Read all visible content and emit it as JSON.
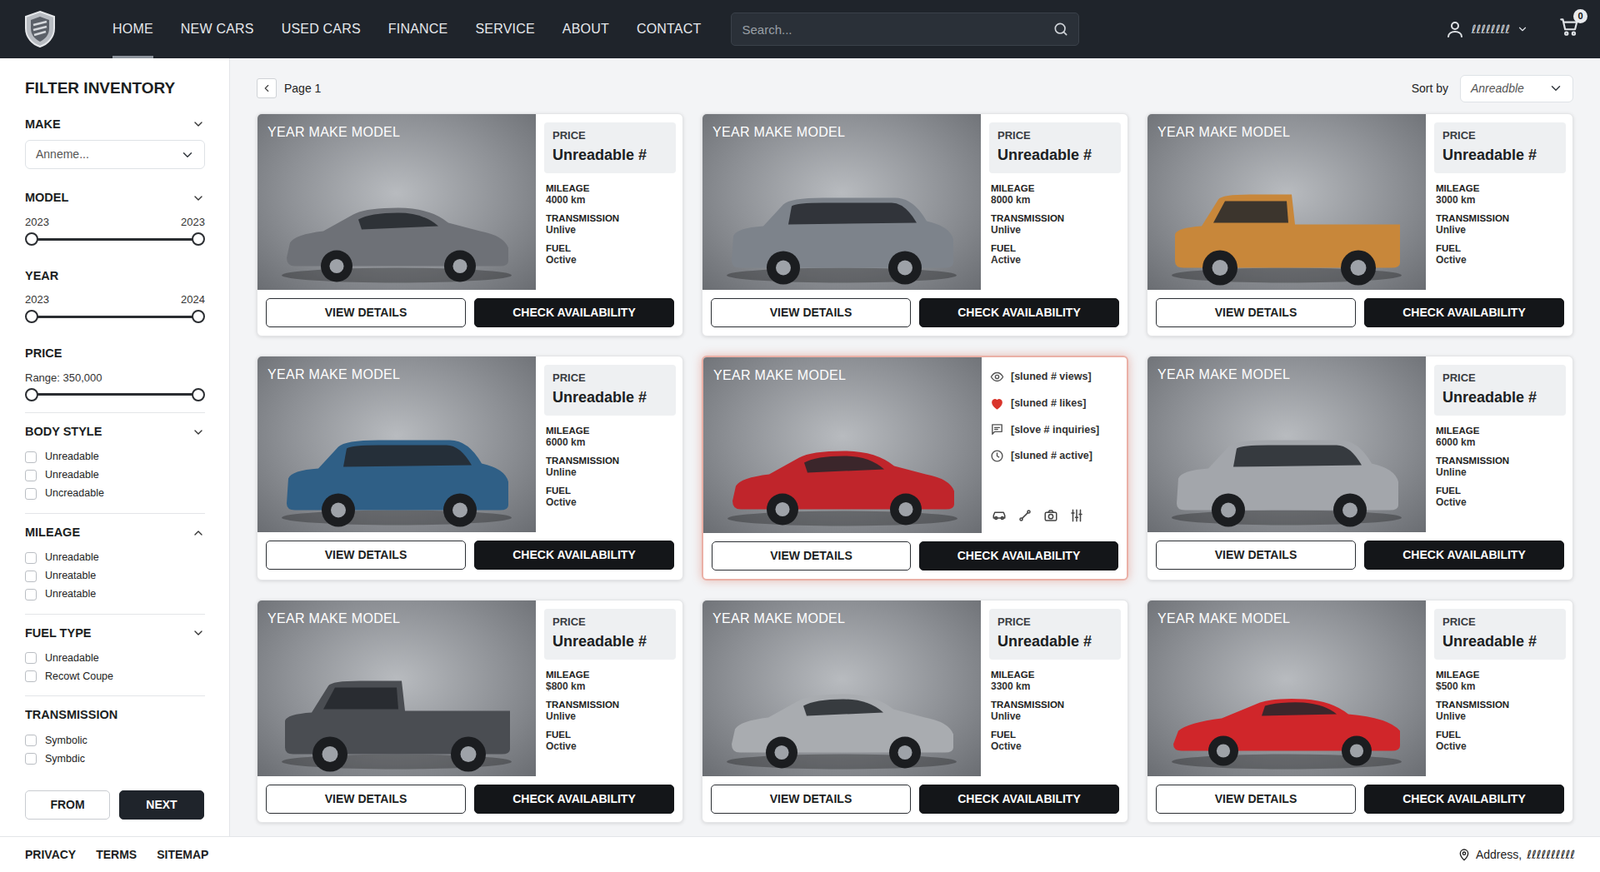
{
  "nav": {
    "items": [
      {
        "label": "HOME",
        "selected": true
      },
      {
        "label": "NEW CARS",
        "selected": false
      },
      {
        "label": "USED CARS",
        "selected": false
      },
      {
        "label": "FINANCE",
        "selected": false
      },
      {
        "label": "SERVICE",
        "selected": false
      },
      {
        "label": "ABOUT",
        "selected": false
      },
      {
        "label": "CONTACT",
        "selected": false
      }
    ]
  },
  "search": {
    "placeholder": "Search..."
  },
  "user": {
    "name": "ℓℓℓℓℓℓℓℓ"
  },
  "cart": {
    "count": "0"
  },
  "sidebar": {
    "title": "FILTER INVENTORY",
    "sections": [
      {
        "kind": "select",
        "title": "MAKE",
        "collapsible": true,
        "expanded": false,
        "value": "Anneme..."
      },
      {
        "kind": "range",
        "title": "MODEL",
        "collapsible": true,
        "expanded": false,
        "min": "2023",
        "max": "2023",
        "low": 0,
        "level": 1
      },
      {
        "kind": "range",
        "title": "YEAR",
        "collapsible": false,
        "min": "2023",
        "max": "2024",
        "low": 0,
        "level": 1
      },
      {
        "kind": "range",
        "title": "PRICE",
        "collapsible": false,
        "reading": "Range: 350,000",
        "low": 0,
        "level": 1
      },
      {
        "kind": "checks",
        "title": "BODY STYLE",
        "collapsible": true,
        "expanded": false,
        "options": [
          {
            "label": "Unreadable",
            "checked": false
          },
          {
            "label": "Unreadable",
            "checked": false
          },
          {
            "label": "Uncreadable",
            "checked": false
          }
        ]
      },
      {
        "kind": "checks",
        "title": "MILEAGE",
        "collapsible": true,
        "expanded": true,
        "options": [
          {
            "label": "Unreadable",
            "checked": false
          },
          {
            "label": "Unreatable",
            "checked": false
          },
          {
            "label": "Unreatable",
            "checked": false
          }
        ]
      },
      {
        "kind": "checks",
        "title": "FUEL TYPE",
        "collapsible": true,
        "expanded": false,
        "options": [
          {
            "label": "Unreadable",
            "checked": false
          },
          {
            "label": "Recowt Coupe",
            "checked": false
          }
        ]
      },
      {
        "kind": "checks",
        "title": "TRANSMISSION",
        "collapsible": false,
        "options": [
          {
            "label": "Symbolic",
            "checked": false
          },
          {
            "label": "Symbdic",
            "checked": false
          }
        ]
      }
    ],
    "buttons": [
      {
        "label": "FROM",
        "kind": "outline"
      },
      {
        "label": "NEXT",
        "kind": "solid"
      }
    ]
  },
  "pager": {
    "label": "Page 1"
  },
  "sort": {
    "label": "Sort by",
    "value": "Anreadble"
  },
  "cards": [
    {
      "title": "YEAR MAKE MODEL",
      "selected": false,
      "kind": "specs",
      "image": {
        "kind": "sedan",
        "color": "#6e7177"
      },
      "price_label": "PRICE",
      "price": "Unreadable #",
      "specs": [
        {
          "label": "MILEAGE",
          "value": "4000 km"
        },
        {
          "label": "TRANSMISSION",
          "value": "Unlive"
        },
        {
          "label": "FUEL",
          "value": "Octive"
        }
      ],
      "buttons": [
        "VIEW DETAILS",
        "CHECK AVAILABILITY"
      ]
    },
    {
      "title": "YEAR MAKE MODEL",
      "selected": false,
      "kind": "specs",
      "image": {
        "kind": "suv",
        "color": "#7d838b"
      },
      "price_label": "PRICE",
      "price": "Unreadable #",
      "specs": [
        {
          "label": "MILEAGE",
          "value": "8000 km"
        },
        {
          "label": "TRANSMISSION",
          "value": "Unlive"
        },
        {
          "label": "FUEL",
          "value": "Active"
        }
      ],
      "buttons": [
        "VIEW DETAILS",
        "CHECK AVAILABILITY"
      ]
    },
    {
      "title": "YEAR MAKE MODEL",
      "selected": false,
      "kind": "specs",
      "image": {
        "kind": "truck",
        "color": "#c8873a"
      },
      "price_label": "PRICE",
      "price": "Unreadable #",
      "specs": [
        {
          "label": "MILEAGE",
          "value": "3000 km"
        },
        {
          "label": "TRANSMISSION",
          "value": "Unlive"
        },
        {
          "label": "FUEL",
          "value": "Octive"
        }
      ],
      "buttons": [
        "VIEW DETAILS",
        "CHECK AVAILABILITY"
      ]
    },
    {
      "title": "YEAR MAKE MODEL",
      "selected": false,
      "kind": "specs",
      "image": {
        "kind": "suv",
        "color": "#2f5f86"
      },
      "price_label": "PRICE",
      "price": "Unreadable #",
      "specs": [
        {
          "label": "MILEAGE",
          "value": "6000 km"
        },
        {
          "label": "TRANSMISSION",
          "value": "Unline"
        },
        {
          "label": "FUEL",
          "value": "Octive"
        }
      ],
      "buttons": [
        "VIEW DETAILS",
        "CHECK AVAILABILITY"
      ]
    },
    {
      "title": "YEAR MAKE MODEL",
      "selected": true,
      "kind": "stats",
      "image": {
        "kind": "sedan",
        "color": "#c0252b"
      },
      "stats": [
        {
          "text": "[sluned # views]",
          "highlighted": false
        },
        {
          "text": "[sluned # likes]",
          "highlighted": true
        },
        {
          "text": "[slove # inquiries]",
          "highlighted": false
        },
        {
          "text": "[sluned # active]",
          "highlighted": false
        }
      ],
      "buttons": [
        "VIEW DETAILS",
        "CHECK AVAILABILITY"
      ]
    },
    {
      "title": "YEAR MAKE MODEL",
      "selected": false,
      "kind": "specs",
      "image": {
        "kind": "suv",
        "color": "#a3a6ab"
      },
      "price_label": "PRICE",
      "price": "Unreadable #",
      "specs": [
        {
          "label": "MILEAGE",
          "value": "6000 km"
        },
        {
          "label": "TRANSMISSION",
          "value": "Unline"
        },
        {
          "label": "FUEL",
          "value": "Octive"
        }
      ],
      "buttons": [
        "VIEW DETAILS",
        "CHECK AVAILABILITY"
      ]
    },
    {
      "title": "YEAR MAKE MODEL",
      "selected": false,
      "kind": "specs",
      "image": {
        "kind": "truck",
        "color": "#4a4d52"
      },
      "price_label": "PRICE",
      "price": "Unreadable #",
      "specs": [
        {
          "label": "MILEAGE",
          "value": "$800 km"
        },
        {
          "label": "TRANSMISSION",
          "value": "Unlive"
        },
        {
          "label": "FUEL",
          "value": "Octive"
        }
      ],
      "buttons": [
        "VIEW DETAILS",
        "CHECK AVAILABILITY"
      ]
    },
    {
      "title": "YEAR MAKE MODEL",
      "selected": false,
      "kind": "specs",
      "image": {
        "kind": "sedan",
        "color": "#a9acb0"
      },
      "price_label": "PRICE",
      "price": "Unreadable #",
      "specs": [
        {
          "label": "MILEAGE",
          "value": "3300 km"
        },
        {
          "label": "TRANSMISSION",
          "value": "Unlive"
        },
        {
          "label": "FUEL",
          "value": "Octive"
        }
      ],
      "buttons": [
        "VIEW DETAILS",
        "CHECK AVAILABILITY"
      ]
    },
    {
      "title": "YEAR MAKE MODEL",
      "selected": false,
      "kind": "specs",
      "image": {
        "kind": "coupe",
        "color": "#d0262a"
      },
      "price_label": "PRICE",
      "price": "Unreadable #",
      "specs": [
        {
          "label": "MILEAGE",
          "value": "$500 km"
        },
        {
          "label": "TRANSMISSION",
          "value": "Unlive"
        },
        {
          "label": "FUEL",
          "value": "Octive"
        }
      ],
      "buttons": [
        "VIEW DETAILS",
        "CHECK AVAILABILITY"
      ]
    }
  ],
  "footer": {
    "links": [
      "PRIVACY",
      "TERMS",
      "SITEMAP"
    ],
    "address_label": "Address,",
    "address_value": "ℓℓℓℓℓℓℓℓℓℓ"
  }
}
